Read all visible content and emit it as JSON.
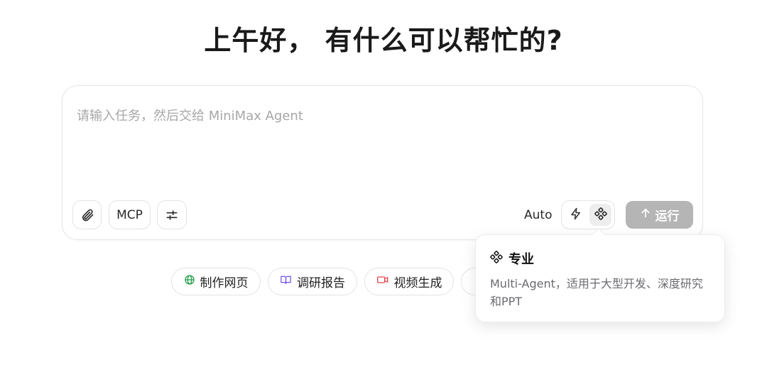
{
  "greeting": "上午好， 有什么可以帮忙的?",
  "composer": {
    "placeholder": "请输入任务，然后交给 MiniMax Agent",
    "attach_icon": "paperclip-icon",
    "mcp_label": "MCP",
    "settings_icon": "sliders-icon",
    "mode_label": "Auto",
    "mode_options": [
      {
        "icon": "lightning-icon",
        "active": false
      },
      {
        "icon": "multi-agent-icon",
        "active": true
      }
    ],
    "run_label": "运行",
    "run_icon": "arrow-up-icon"
  },
  "quick_actions": [
    {
      "label": "制作网页",
      "icon": "globe-icon",
      "icon_color": "#22a04b"
    },
    {
      "label": "调研报告",
      "icon": "book-icon",
      "icon_color": "#7b5cf0"
    },
    {
      "label": "视频生成",
      "icon": "video-icon",
      "icon_color": "#e5484d"
    },
    {
      "label": "",
      "icon": "partially-hidden-chip",
      "icon_color": "#555555"
    }
  ],
  "tooltip": {
    "title": "专业",
    "icon": "multi-agent-icon",
    "description": "Multi-Agent，适用于大型开发、深度研究和PPT"
  },
  "colors": {
    "run_button_disabled": "#b5b5b5",
    "placeholder": "#a7a7aa",
    "border": "#e3e3e3"
  }
}
